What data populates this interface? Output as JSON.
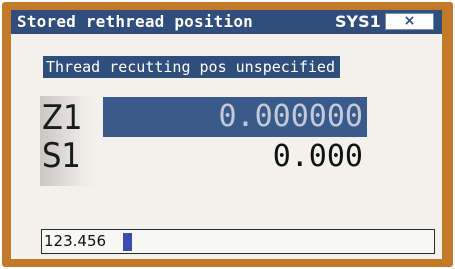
{
  "window": {
    "title": "Stored rethread position",
    "system": "SYS1",
    "close_glyph": "×"
  },
  "status": {
    "message": "Thread recutting pos unspecified"
  },
  "axes": [
    {
      "name": "Z1",
      "value": "0.000000",
      "selected": true
    },
    {
      "name": "S1",
      "value": "0.000",
      "selected": false
    }
  ],
  "input": {
    "value": "123.456"
  },
  "colors": {
    "frame": "#c27a29",
    "titlebar": "#2f4e7c",
    "highlight": "#3a5a8c",
    "panel": "#f3f1ec",
    "cursor": "#3a4db0"
  },
  "icons": {
    "close": "close-icon"
  }
}
